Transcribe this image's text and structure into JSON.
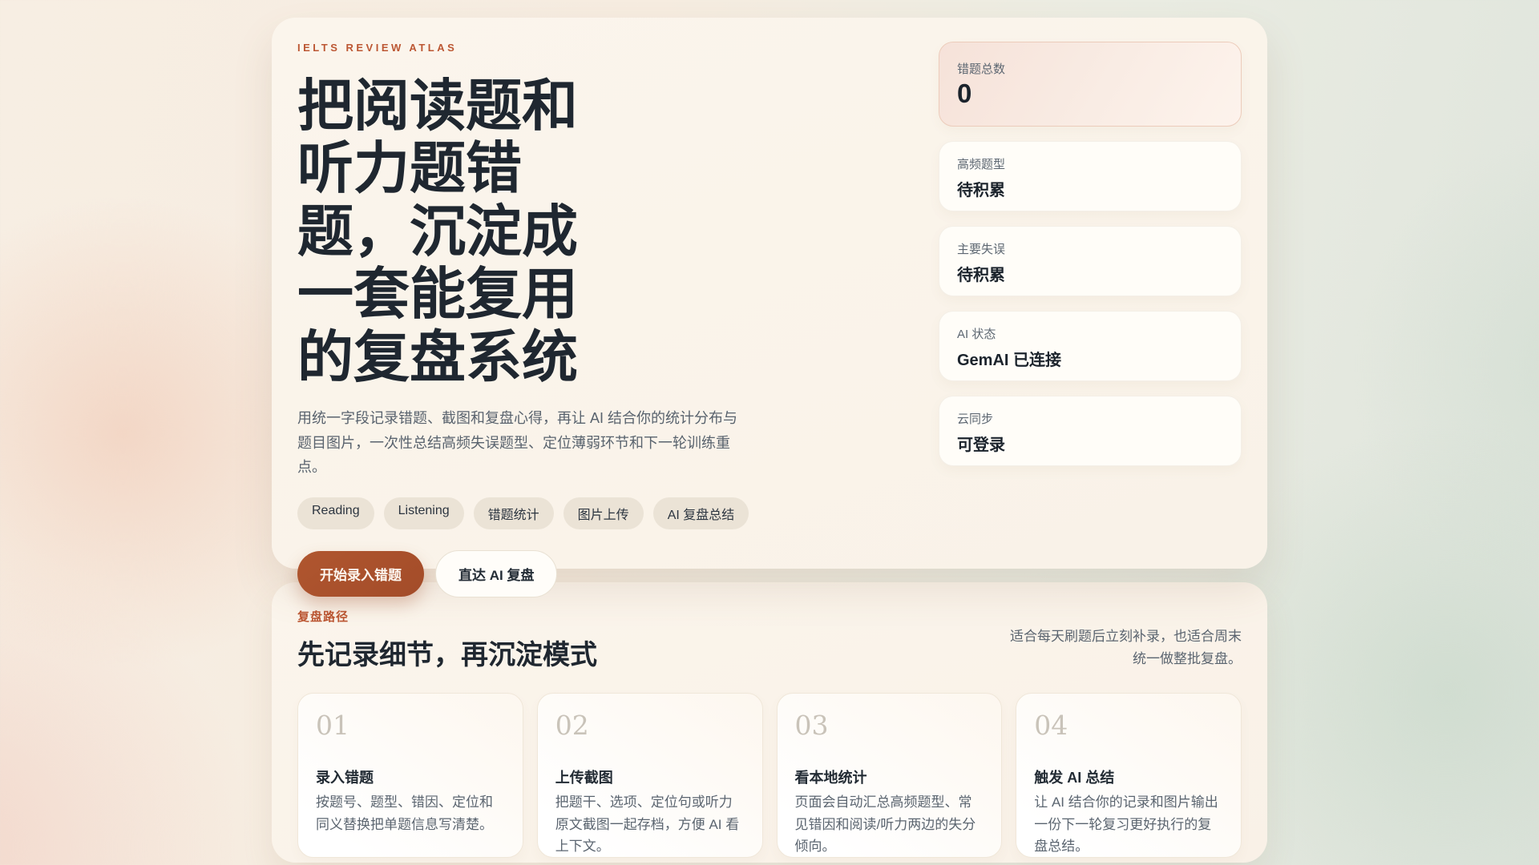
{
  "theme": {
    "accent": "#bc5733",
    "primary_button_bg": "#a84f2b",
    "heading_color": "#1f2730",
    "muted_color": "#5b6570",
    "card_bg": "#faf3ea",
    "highlight_card_border": "#ecccbb",
    "page_bg_left": "#f7eee3",
    "page_bg_right": "#dee4dc"
  },
  "hero": {
    "eyebrow": "IELTS REVIEW ATLAS",
    "title": "把阅读题和听力题错题，沉淀成一套能复用的复盘系统",
    "description": "用统一字段记录错题、截图和复盘心得，再让 AI 结合你的统计分布与题目图片，一次性总结高频失误题型、定位薄弱环节和下一轮训练重点。",
    "tags": [
      "Reading",
      "Listening",
      "错题统计",
      "图片上传",
      "AI 复盘总结"
    ],
    "primary_button": "开始录入错题",
    "secondary_button": "直达 AI 复盘",
    "stats": [
      {
        "label": "错题总数",
        "value": "0"
      },
      {
        "label": "高频题型",
        "value": "待积累"
      },
      {
        "label": "主要失误",
        "value": "待积累"
      },
      {
        "label": "AI 状态",
        "value": "GemAI 已连接"
      },
      {
        "label": "云同步",
        "value": "可登录"
      }
    ]
  },
  "path_section": {
    "eyebrow": "复盘路径",
    "title": "先记录细节，再沉淀模式",
    "note": "适合每天刷题后立刻补录，也适合周末统一做整批复盘。",
    "steps": [
      {
        "number": "01",
        "title": "录入错题",
        "description": "按题号、题型、错因、定位和同义替换把单题信息写清楚。"
      },
      {
        "number": "02",
        "title": "上传截图",
        "description": "把题干、选项、定位句或听力原文截图一起存档，方便 AI 看上下文。"
      },
      {
        "number": "03",
        "title": "看本地统计",
        "description": "页面会自动汇总高频题型、常见错因和阅读/听力两边的失分倾向。"
      },
      {
        "number": "04",
        "title": "触发 AI 总结",
        "description": "让 AI 结合你的记录和图片输出一份下一轮复习更好执行的复盘总结。"
      }
    ]
  }
}
